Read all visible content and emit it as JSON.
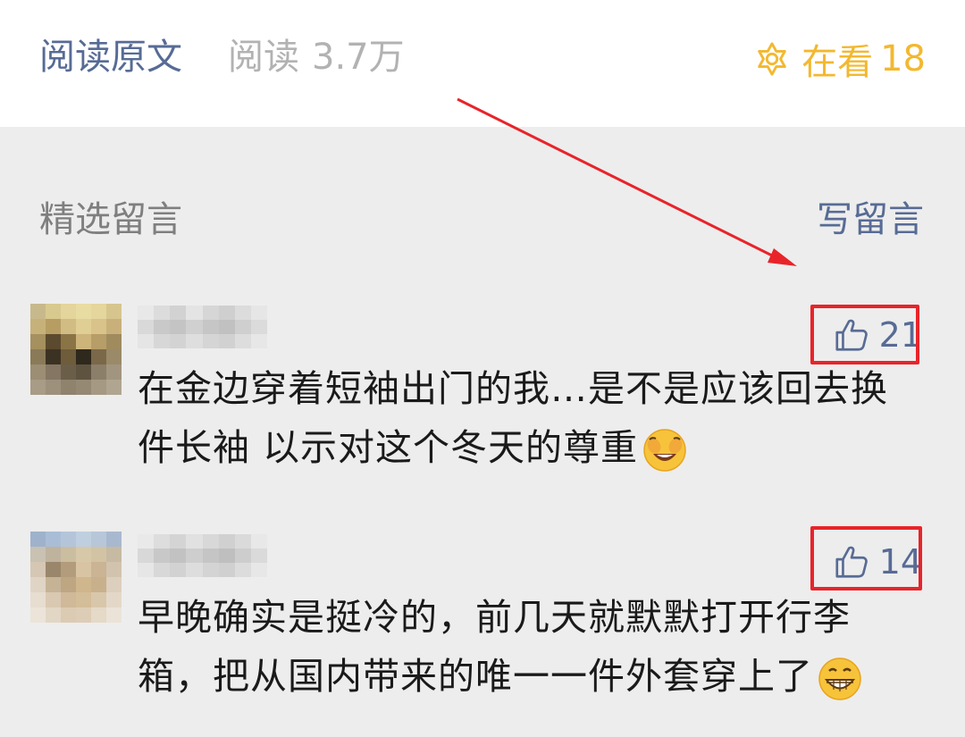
{
  "header": {
    "read_original": "阅读原文",
    "read_label": "阅读",
    "read_count": "3.7万",
    "looking_label": "在看",
    "looking_count": "18",
    "accent_color": "#576b95",
    "looking_color": "#f3b82f"
  },
  "comments_section": {
    "title": "精选留言",
    "write_label": "写留言",
    "items": [
      {
        "text": "在金边穿着短袖出门的我…是不是应该回去换件长袖 以示对这个冬天的尊重",
        "emoji": "laughing-crying-emoji",
        "likes": "21"
      },
      {
        "text": "早晚确实是挺冷的，前几天就默默打开行李箱，把从国内带来的唯一一件外套穿上了",
        "emoji": "grinning-emoji",
        "likes": "14"
      }
    ]
  },
  "annotation": {
    "highlight_color": "#e8242a"
  }
}
